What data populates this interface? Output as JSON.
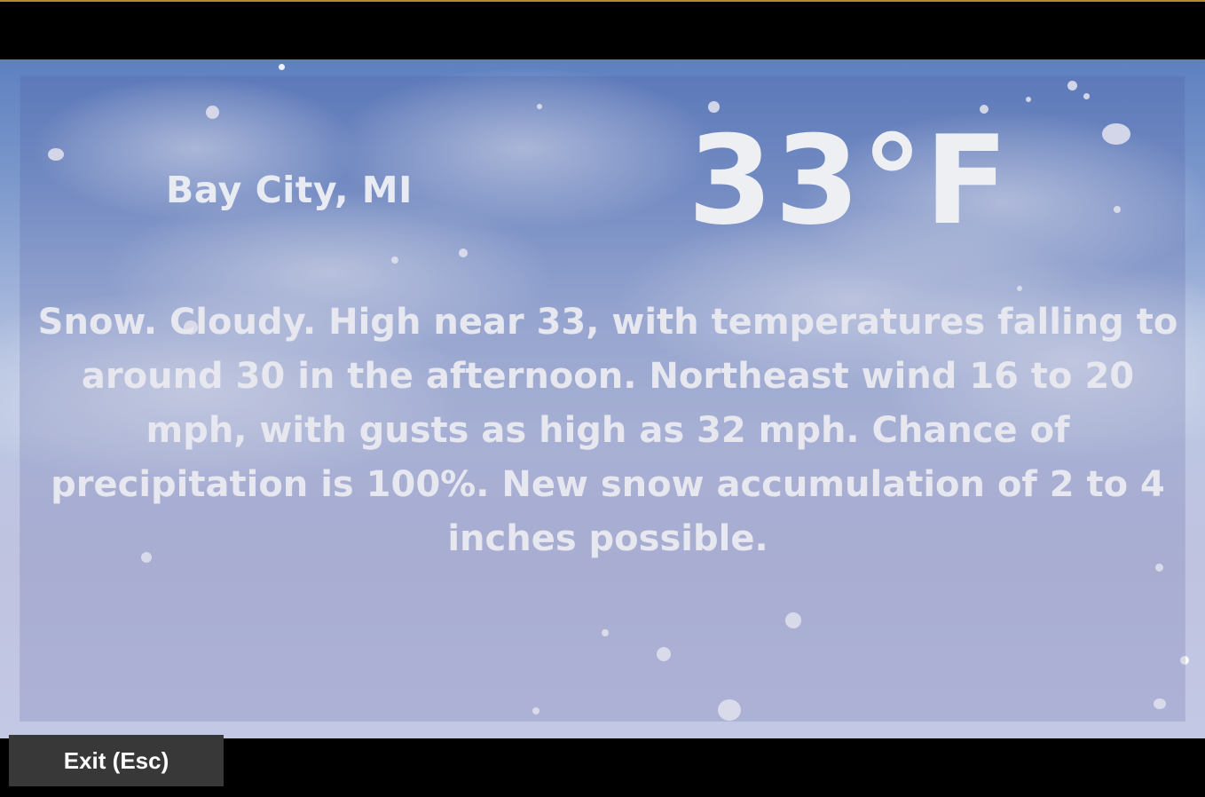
{
  "weather": {
    "location": "Bay City, MI",
    "temperature": "33°F",
    "forecast": "Snow. Cloudy. High near 33, with temperatures falling to around 30 in the afternoon. Northeast wind 16 to 20 mph, with gusts as high as 32 mph. Chance of precipitation is 100%. New snow accumulation of 2 to 4 inches possible."
  },
  "controls": {
    "exit_label": "Exit (Esc)"
  }
}
